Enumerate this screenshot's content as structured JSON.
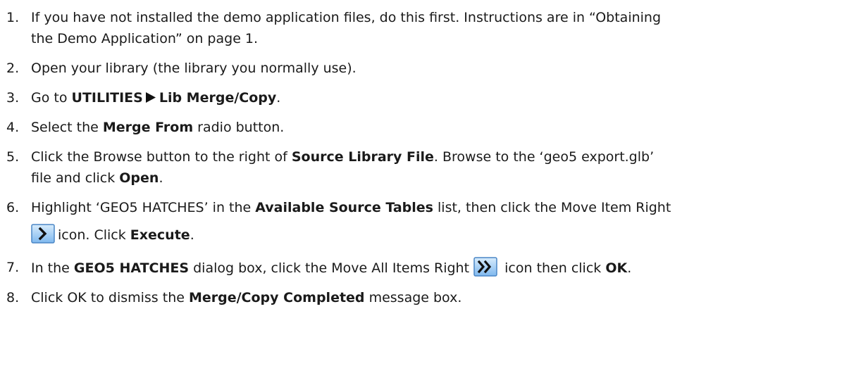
{
  "steps": [
    {
      "number": "1.",
      "line1": "If you have not installed the demo application files, do this first. Instructions are in “Obtaining",
      "line2": "the Demo Application” on page 1."
    },
    {
      "number": "2.",
      "text": "Open your library (the library you normally use)."
    },
    {
      "number": "3.",
      "prefix": "Go to ",
      "menu1": "UTILITIES",
      "menu2": "Lib Merge/Copy",
      "suffix": "."
    },
    {
      "number": "4.",
      "prefix": "Select the ",
      "bold": "Merge From",
      "suffix": " radio button."
    },
    {
      "number": "5.",
      "prefix": "Click the Browse button to the right of ",
      "bold1": "Source Library File",
      "middle": ". Browse to the ‘geo5 export.glb’",
      "line2_prefix": "file and click ",
      "bold2": "Open",
      "line2_suffix": "."
    },
    {
      "number": "6.",
      "prefix": "Highlight ‘GEO5 HATCHES’ in the ",
      "bold1": "Available Source Tables",
      "middle": " list, then click the Move Item Right",
      "line2_middle": "icon. Click ",
      "bold2": "Execute",
      "line2_suffix": ".",
      "icon": "move-item-right-icon"
    },
    {
      "number": "7.",
      "prefix": "In the ",
      "bold1": "GEO5 HATCHES",
      "middle": " dialog box, click the Move All Items Right ",
      "after_icon": " icon then click ",
      "bold2": "OK",
      "suffix": ".",
      "icon": "move-all-items-right-icon"
    },
    {
      "number": "8.",
      "prefix": "Click OK to dismiss the ",
      "bold": "Merge/Copy Completed",
      "suffix": " message box."
    }
  ],
  "colors": {
    "text": "#1a1a1a",
    "icon_fill_top": "#d8ecfc",
    "icon_fill_bottom": "#7fb8ee",
    "icon_border": "#4a86c5",
    "icon_glyph": "#111111"
  }
}
